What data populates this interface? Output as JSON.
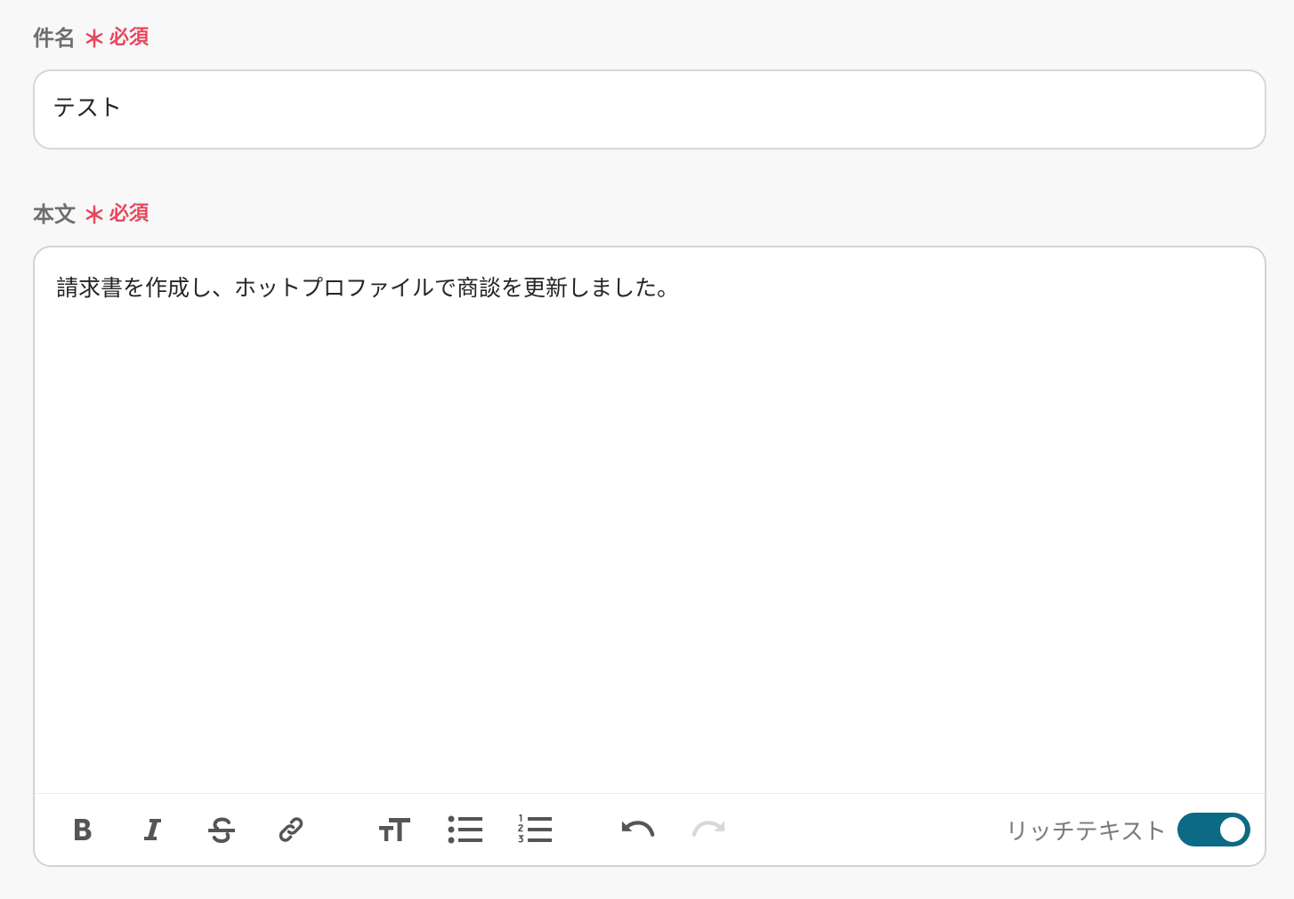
{
  "subject": {
    "label": "件名",
    "asterisk": "＊",
    "required": "必須",
    "value": "テスト"
  },
  "body": {
    "label": "本文",
    "asterisk": "＊",
    "required": "必須",
    "value": "請求書を作成し、ホットプロファイルで商談を更新しました。"
  },
  "toolbar": {
    "icons": [
      "bold-icon",
      "italic-icon",
      "strikethrough-icon",
      "link-icon",
      "text-size-icon",
      "bullet-list-icon",
      "numbered-list-icon",
      "undo-icon",
      "redo-icon"
    ],
    "rich_text_label": "リッチテキスト",
    "rich_text_enabled": true
  },
  "colors": {
    "required": "#e8475d",
    "toggle_on": "#0d6a84",
    "label": "#6e6e6e"
  }
}
